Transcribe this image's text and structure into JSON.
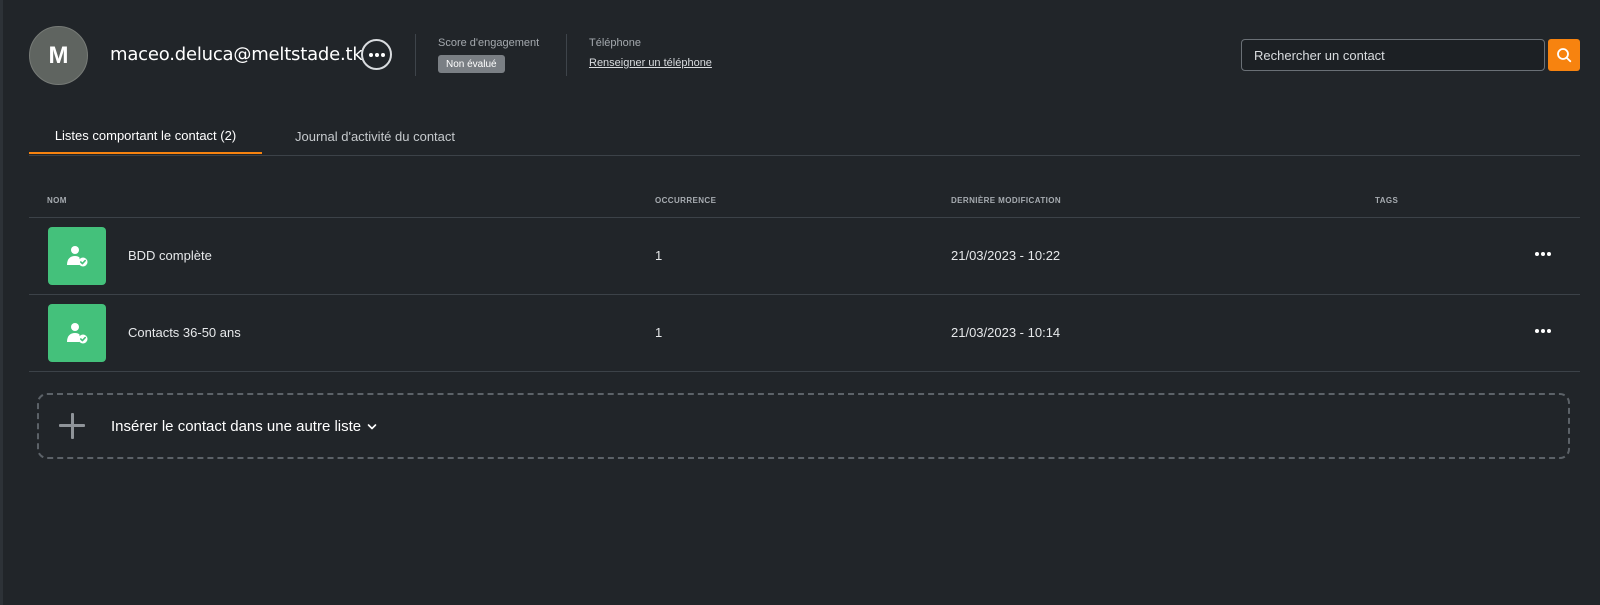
{
  "header": {
    "avatar_initial": "M",
    "email": "maceo.deluca@meltstade.tk",
    "engagement_label": "Score d'engagement",
    "engagement_badge": "Non évalué",
    "phone_label": "Téléphone",
    "phone_link": "Renseigner un téléphone",
    "search_placeholder": "Rechercher un contact"
  },
  "tabs": [
    {
      "label": "Listes comportant le contact (2)",
      "active": true
    },
    {
      "label": "Journal d'activité du contact",
      "active": false
    }
  ],
  "table": {
    "columns": [
      "NOM",
      "OCCURRENCE",
      "DERNIÈRE MODIFICATION",
      "TAGS"
    ],
    "rows": [
      {
        "name": "BDD complète",
        "occurrence": "1",
        "modified": "21/03/2023 - 10:22",
        "tags": ""
      },
      {
        "name": "Contacts 36-50 ans",
        "occurrence": "1",
        "modified": "21/03/2023 - 10:14",
        "tags": ""
      }
    ]
  },
  "add_list": {
    "label": "Insérer le contact dans une autre liste"
  },
  "colors": {
    "accent": "#f7830f",
    "list_icon": "#44c17b",
    "background": "#212529"
  },
  "icons": {
    "search": "search-icon",
    "more": "more-horizontal-icon",
    "list": "user-check-icon",
    "add": "plus-icon",
    "chevron": "chevron-down-icon"
  }
}
